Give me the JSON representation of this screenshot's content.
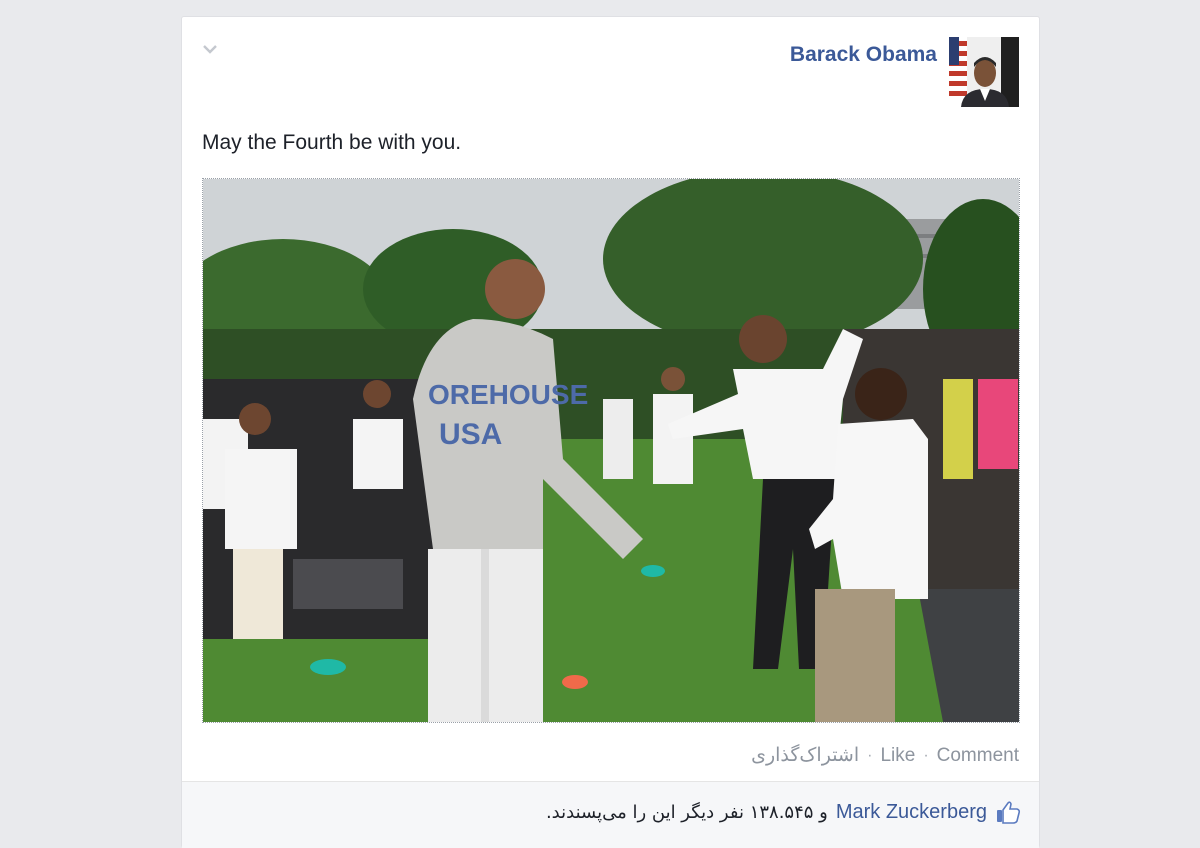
{
  "post": {
    "author": "Barack Obama",
    "text": "May the Fourth be with you.",
    "photo_jersey_line1": "OREHOUSE",
    "photo_jersey_line2": "USA"
  },
  "actions": {
    "comment": "Comment",
    "like": "Like",
    "share": "اشتراک‌گذاری",
    "separator": "·"
  },
  "likes": {
    "liker": "Mark Zuckerberg",
    "rest": "و ۱۳۸.۵۴۵ نفر دیگر این را می‌پسندند."
  },
  "icons": {
    "options": "chevron-down-icon",
    "like": "thumbs-up-icon"
  },
  "colors": {
    "link_blue": "#3b5998",
    "page_bg": "#e9eaed",
    "muted": "#8d949e"
  }
}
